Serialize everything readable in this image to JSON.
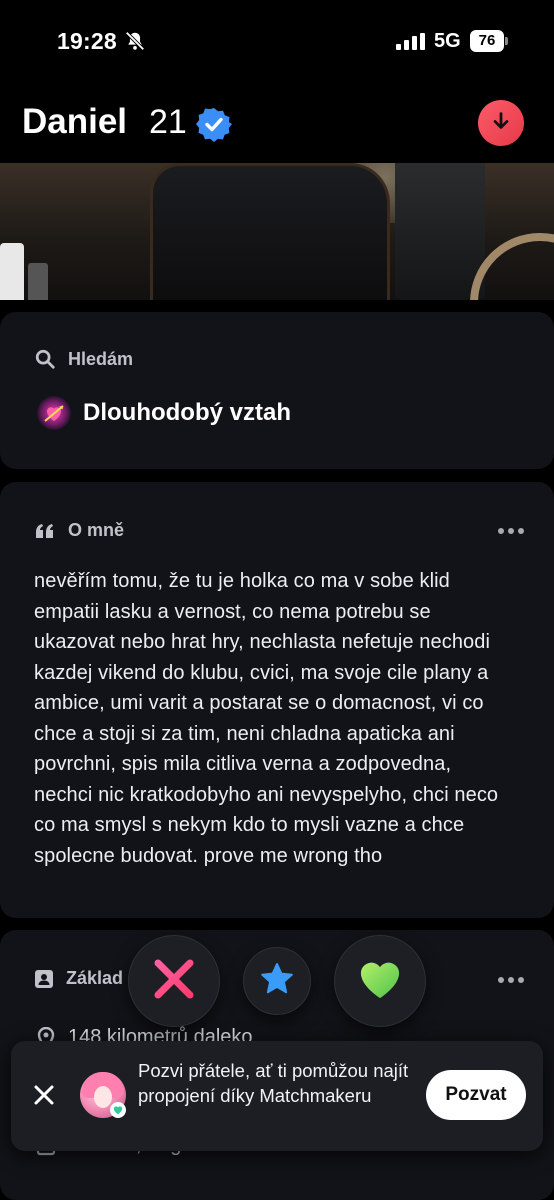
{
  "status_bar": {
    "time": "19:28",
    "network": "5G",
    "battery": "76",
    "icons": [
      "bell-slash-icon",
      "signal-icon",
      "battery-icon"
    ]
  },
  "profile": {
    "name": "Daniel",
    "age": "21",
    "verified": true,
    "verified_icon": "verified-badge-icon",
    "collapse_icon": "arrow-down-icon"
  },
  "looking_for": {
    "heading": "Hledám",
    "heading_icon": "search-icon",
    "value": "Dlouhodobý vztah",
    "value_icon": "heart-arrow-icon"
  },
  "about": {
    "heading": "O mně",
    "heading_icon": "quote-icon",
    "more_icon": "more-horizontal-icon",
    "text": "nevěřím tomu, že tu je holka co ma v sobe klid empatii lasku a vernost, co nema potrebu se ukazovat nebo hrat hry, nechlasta nefetuje nechodi kazdej vikend do klubu, cvici, ma svoje cile plany a ambice, umi varit a postarat se o domacnost, vi co chce a stoji si za tim, neni chladna apaticka ani povrchni, spis mila citliva verna a zodpovedna, nechci nic kratkodobyho ani nevyspelyho, chci neco co ma smysl s nekym kdo to mysli vazne a chce spolecne budovat. prove me wrong tho"
  },
  "basics": {
    "heading": "Základ",
    "heading_icon": "id-card-icon",
    "more_icon": "more-horizontal-icon",
    "distance": "148 kilometrů daleko",
    "distance_icon": "location-pin-icon",
    "languages": "Čeština, Angličtina",
    "languages_icon": "language-icon"
  },
  "actions": {
    "nope_icon": "x-icon",
    "super_like_icon": "star-icon",
    "like_icon": "heart-icon",
    "nope_color": "#ff4f8b",
    "super_like_color": "#3a9cf8",
    "like_color": "#7ed957"
  },
  "toast": {
    "text": "Pozvi přátele, ať ti pomůžou najít propojení díky Matchmakeru",
    "button_label": "Pozvat",
    "close_icon": "close-icon",
    "avatar_badge_icon": "heart-icon"
  },
  "colors": {
    "background": "#000000",
    "card": "#121318",
    "accent_red": "#fd5b6a",
    "verified_blue": "#3a8ef6"
  }
}
